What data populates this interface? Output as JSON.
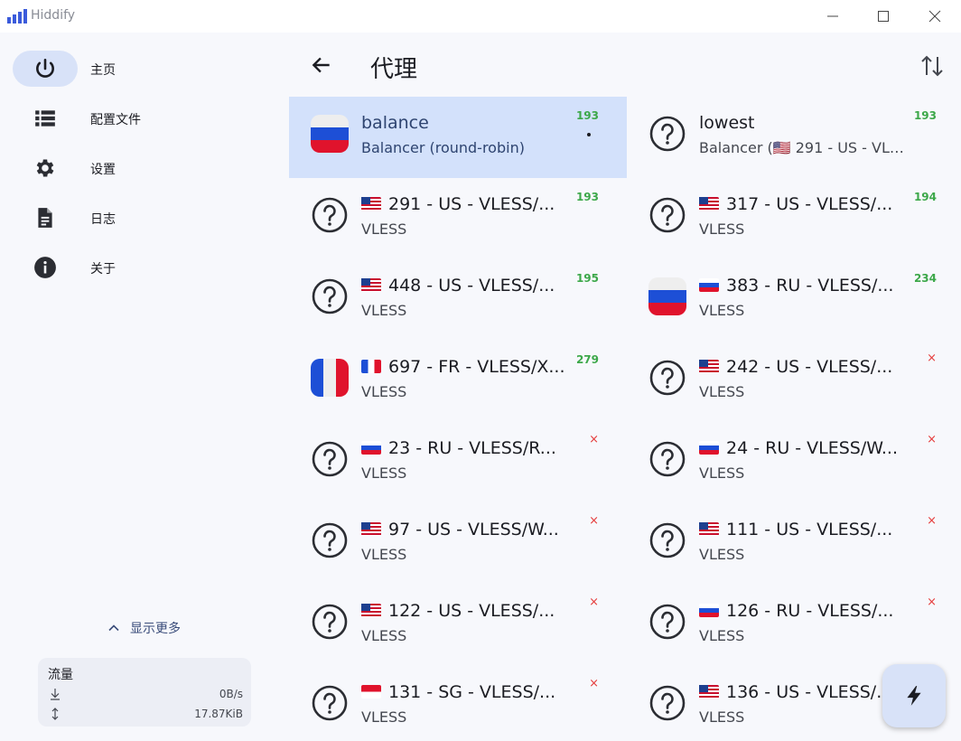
{
  "app": {
    "title": "Hiddify"
  },
  "sidebar": {
    "items": [
      {
        "label": "主页",
        "icon": "power-icon",
        "active": true
      },
      {
        "label": "配置文件",
        "icon": "list-icon",
        "active": false
      },
      {
        "label": "设置",
        "icon": "gear-icon",
        "active": false
      },
      {
        "label": "日志",
        "icon": "document-icon",
        "active": false
      },
      {
        "label": "关于",
        "icon": "info-icon",
        "active": false
      }
    ],
    "show_more": "显示更多",
    "traffic": {
      "title": "流量",
      "download_rate": "0B/s",
      "total": "17.87KiB"
    }
  },
  "header": {
    "title": "代理"
  },
  "proxies": [
    {
      "name": "balance",
      "sub": "Balancer (round-robin)",
      "delay": "193",
      "icon": "flag-ru",
      "flag": "",
      "sub_flag": "",
      "selected": true,
      "status": "ok"
    },
    {
      "name": "lowest",
      "sub": "Balancer (🇺🇸 291 - US - VLESS/...",
      "delay": "193",
      "icon": "question-icon",
      "flag": "",
      "sub_flag": "us",
      "selected": false,
      "status": "ok"
    },
    {
      "name": "291 - US - VLESS/...",
      "sub": "VLESS",
      "delay": "193",
      "icon": "question-icon",
      "flag": "us",
      "sub_flag": "",
      "selected": false,
      "status": "ok"
    },
    {
      "name": "317 - US - VLESS/...",
      "sub": "VLESS",
      "delay": "194",
      "icon": "question-icon",
      "flag": "us",
      "sub_flag": "",
      "selected": false,
      "status": "ok"
    },
    {
      "name": "448 - US - VLESS/...",
      "sub": "VLESS",
      "delay": "195",
      "icon": "question-icon",
      "flag": "us",
      "sub_flag": "",
      "selected": false,
      "status": "ok"
    },
    {
      "name": "383 - RU - VLESS/...",
      "sub": "VLESS",
      "delay": "234",
      "icon": "flag-ru",
      "flag": "ru",
      "sub_flag": "",
      "selected": false,
      "status": "ok"
    },
    {
      "name": "697 - FR - VLESS/X...",
      "sub": "VLESS",
      "delay": "279",
      "icon": "flag-fr",
      "flag": "fr",
      "sub_flag": "",
      "selected": false,
      "status": "ok"
    },
    {
      "name": "242 - US - VLESS/...",
      "sub": "VLESS",
      "delay": "×",
      "icon": "question-icon",
      "flag": "us",
      "sub_flag": "",
      "selected": false,
      "status": "fail"
    },
    {
      "name": "23 - RU - VLESS/R...",
      "sub": "VLESS",
      "delay": "×",
      "icon": "question-icon",
      "flag": "ru",
      "sub_flag": "",
      "selected": false,
      "status": "fail"
    },
    {
      "name": "24 - RU - VLESS/W...",
      "sub": "VLESS",
      "delay": "×",
      "icon": "question-icon",
      "flag": "ru",
      "sub_flag": "",
      "selected": false,
      "status": "fail"
    },
    {
      "name": "97 - US - VLESS/W...",
      "sub": "VLESS",
      "delay": "×",
      "icon": "question-icon",
      "flag": "us",
      "sub_flag": "",
      "selected": false,
      "status": "fail"
    },
    {
      "name": "111 - US - VLESS/...",
      "sub": "VLESS",
      "delay": "×",
      "icon": "question-icon",
      "flag": "us",
      "sub_flag": "",
      "selected": false,
      "status": "fail"
    },
    {
      "name": "122 - US - VLESS/...",
      "sub": "VLESS",
      "delay": "×",
      "icon": "question-icon",
      "flag": "us",
      "sub_flag": "",
      "selected": false,
      "status": "fail"
    },
    {
      "name": "126 - RU - VLESS/...",
      "sub": "VLESS",
      "delay": "×",
      "icon": "question-icon",
      "flag": "ru",
      "sub_flag": "",
      "selected": false,
      "status": "fail"
    },
    {
      "name": "131 - SG - VLESS/...",
      "sub": "VLESS",
      "delay": "×",
      "icon": "question-icon",
      "flag": "sg",
      "sub_flag": "",
      "selected": false,
      "status": "fail"
    },
    {
      "name": "136 - US - VLESS/...",
      "sub": "VLESS",
      "delay": "",
      "icon": "question-icon",
      "flag": "us",
      "sub_flag": "",
      "selected": false,
      "status": "none"
    }
  ],
  "colors": {
    "accent": "#d3e1fb",
    "ok_delay": "#3da84a",
    "fail_delay": "#e53d3d",
    "background": "#f7f8fc"
  }
}
